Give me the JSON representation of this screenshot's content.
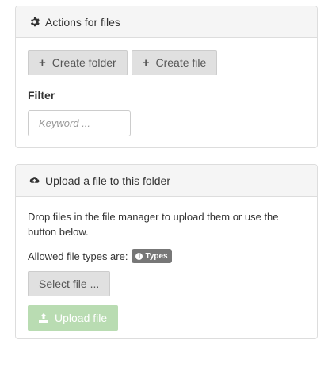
{
  "actions_panel": {
    "title": "Actions for files",
    "create_folder_label": "Create folder",
    "create_file_label": "Create file",
    "filter_label": "Filter",
    "filter_placeholder": "Keyword ..."
  },
  "upload_panel": {
    "title": "Upload a file to this folder",
    "description": "Drop files in the file manager to upload them or use the button below.",
    "allowed_types_label": "Allowed file types are:",
    "types_badge": "Types",
    "select_file_label": "Select file ...",
    "upload_label": "Upload file"
  },
  "icons": {
    "actions": "gear-icon",
    "upload_heading": "cloud-upload-icon",
    "create": "plus-icon",
    "badge": "info-icon",
    "upload_button": "upload-icon"
  },
  "colors": {
    "upload_button_bg": "#b9dcb2",
    "badge_bg": "#777777"
  }
}
